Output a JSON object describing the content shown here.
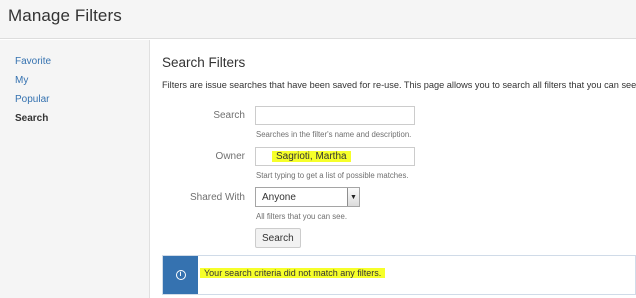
{
  "header": {
    "title": "Manage Filters"
  },
  "sidebar": {
    "items": [
      {
        "label": "Favorite",
        "active": false
      },
      {
        "label": "My",
        "active": false
      },
      {
        "label": "Popular",
        "active": false
      },
      {
        "label": "Search",
        "active": true
      }
    ]
  },
  "main": {
    "title": "Search Filters",
    "description": "Filters are issue searches that have been saved for re-use. This page allows you to search all filters that you can see.",
    "search": {
      "label": "Search",
      "value": "",
      "hint": "Searches in the filter's name and description."
    },
    "owner": {
      "label": "Owner",
      "value": "Sagrioti, Martha",
      "hint": "Start typing to get a list of possible matches."
    },
    "shared_with": {
      "label": "Shared With",
      "selected": "Anyone",
      "hint": "All filters that you can see."
    },
    "search_button": "Search",
    "message": "Your search criteria did not match any filters."
  },
  "colors": {
    "link": "#3572b0",
    "highlight": "#f6ff2a",
    "info_bar": "#3572b0"
  }
}
